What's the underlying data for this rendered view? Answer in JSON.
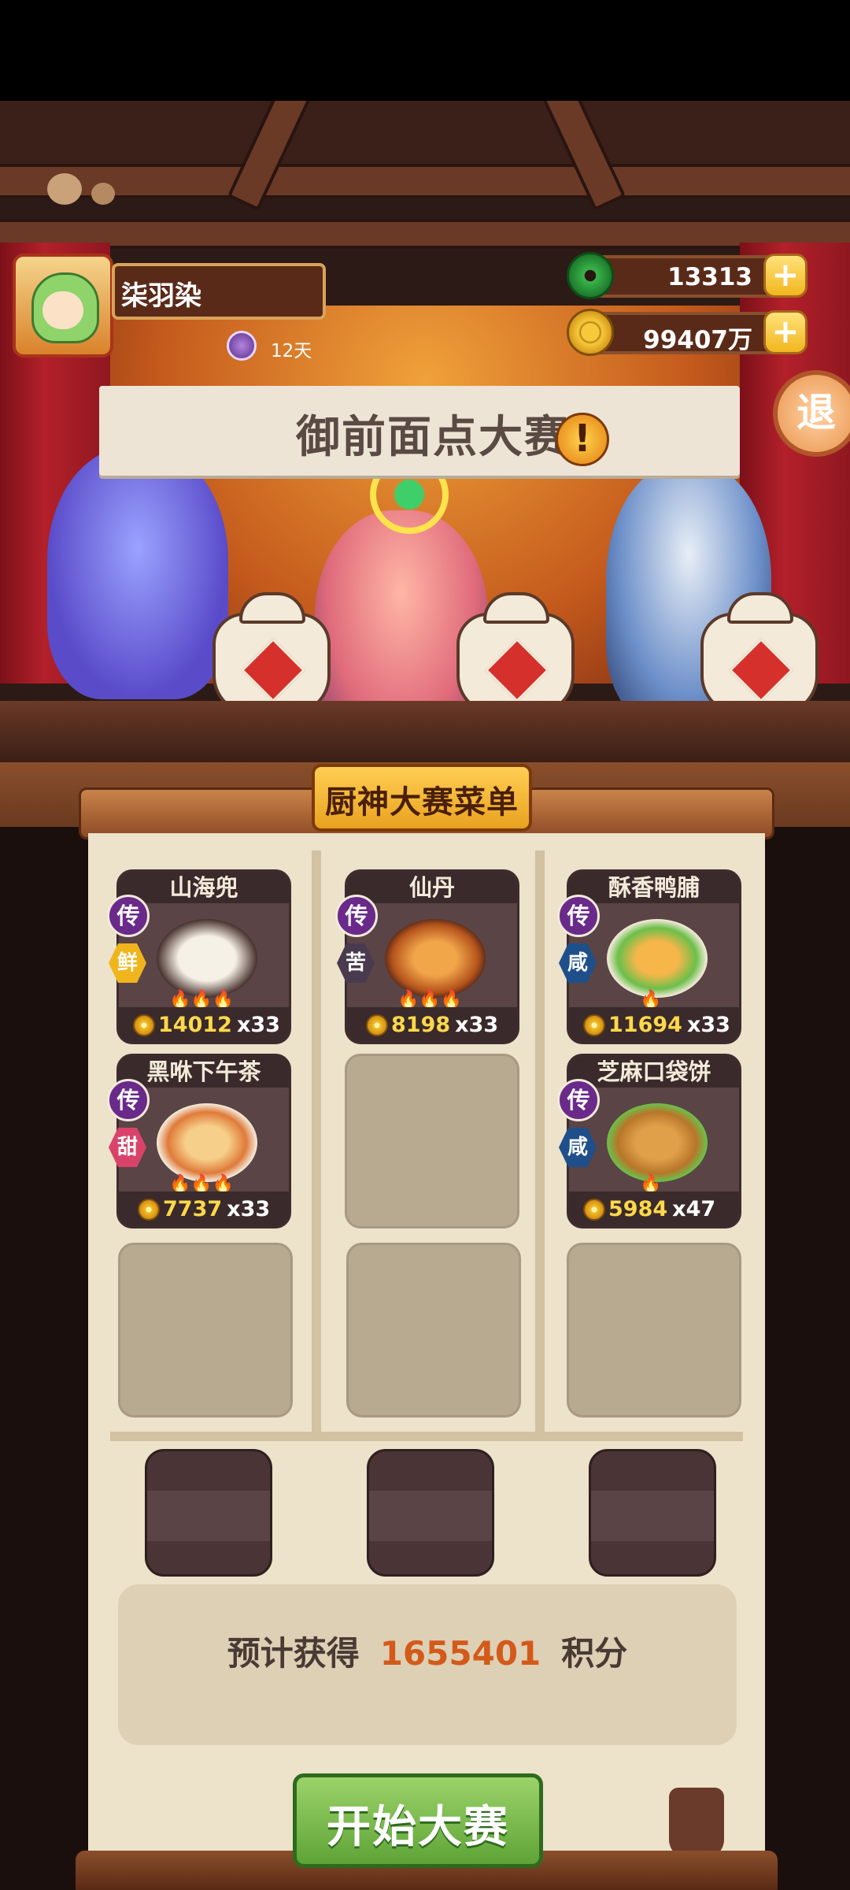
{
  "player": {
    "name": "柒羽染",
    "badge_days": "12天"
  },
  "currency": {
    "jade": "13313",
    "coins": "99407万",
    "plus": "+"
  },
  "exit_label": "退",
  "stage": {
    "banner_text": "御前面点大赛",
    "alert_mark": "!"
  },
  "menu": {
    "title": "厨神大赛菜单",
    "dishes": [
      {
        "name": "山海兜",
        "rarity": "传",
        "flavor": "鲜",
        "flavor_color": "#f0b51c",
        "price": "14012",
        "qty": "x33"
      },
      {
        "name": "仙丹",
        "rarity": "传",
        "flavor": "苦",
        "flavor_color": "#4a3a4e",
        "price": "8198",
        "qty": "x33"
      },
      {
        "name": "酥香鸭脯",
        "rarity": "传",
        "flavor": "咸",
        "flavor_color": "#1e4f8a",
        "price": "11694",
        "qty": "x33"
      },
      {
        "name": "黑咻下午茶",
        "rarity": "传",
        "flavor": "甜",
        "flavor_color": "#d9436a",
        "price": "7737",
        "qty": "x33"
      },
      {
        "name": "芝麻口袋饼",
        "rarity": "传",
        "flavor": "咸",
        "flavor_color": "#1e4f8a",
        "price": "5984",
        "qty": "x47"
      }
    ]
  },
  "points": {
    "label": "预计获得",
    "value": "1655401",
    "unit": "积分"
  },
  "start_button": "开始大赛"
}
